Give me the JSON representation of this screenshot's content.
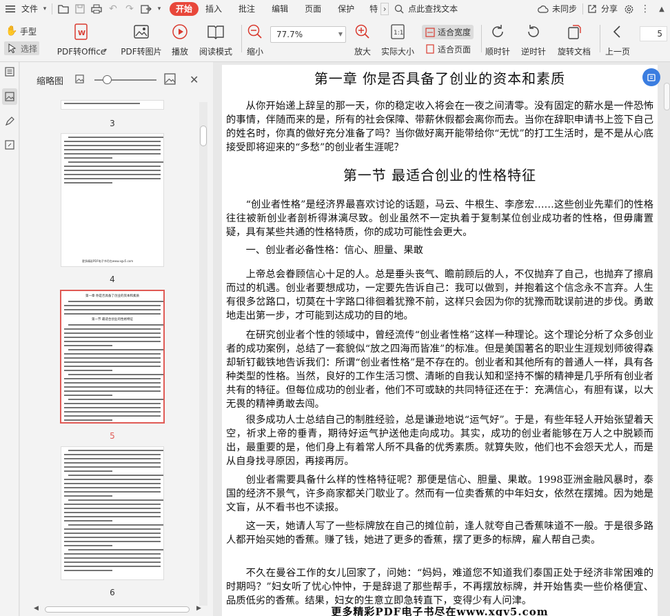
{
  "menubar": {
    "file_label": "文件",
    "tabs": [
      "开始",
      "插入",
      "批注",
      "编辑",
      "页面",
      "保护",
      "特"
    ],
    "search_label": "点此查找文本",
    "sync_label": "未同步",
    "share_label": "分享"
  },
  "ribbon": {
    "hand_label": "手型",
    "select_label": "选择",
    "pdf_to_office_label": "PDF转Office",
    "pdf_to_image_label": "PDF转图片",
    "play_label": "播放",
    "read_mode_label": "阅读模式",
    "zoom_out_label": "缩小",
    "zoom_value": "77.7%",
    "zoom_in_label": "放大",
    "actual_size_label": "实际大小",
    "fit_width_label": "适合宽度",
    "fit_page_label": "适合页面",
    "rotate_cw_label": "顺时针",
    "rotate_ccw_label": "逆时针",
    "rotate_doc_label": "旋转文档",
    "prev_page_label": "上一页",
    "page_number": "5"
  },
  "thumbnail_panel": {
    "title": "缩略图",
    "pages": [
      {
        "label": "3",
        "selected": false
      },
      {
        "label": "4",
        "selected": false
      },
      {
        "label": "5",
        "selected": true
      },
      {
        "label": "6",
        "selected": false
      }
    ],
    "thumb4_footer": "更多精彩PDF电子书尽在www.xgv5.com",
    "thumb5_title": "第一章 你是否具备了创业的资本和素质",
    "thumb5_section": "第一节 最适合创业的性格特征"
  },
  "document": {
    "chapter_title": "第一章 你是否具备了创业的资本和素质",
    "intro": "从你开始递上辞呈的那一天，你的稳定收入将会在一夜之间清零。没有固定的薪水是一件恐怖的事情，伴随而来的是，所有的社会保障、带薪休假都会离你而去。当你在辞职申请书上签下自己的姓名时，你真的做好充分准备了吗？当你做好离开能带给你“无忧”的打工生活时，是不是从心底接受即将迎来的“多愁”的创业者生涯呢？",
    "section_title": "第一节 最适合创业的性格特征",
    "p1": "“创业者性格”是经济界最喜欢讨论的话题，马云、牛根生、李彦宏……这些创业先辈们的性格往往被新创业者剖析得淋漓尽致。创业虽然不一定执着于复制某位创业成功者的性格，但毋庸置疑，具有某些共通的性格特质，你的成功可能性会更大。",
    "p2": "一、创业者必备性格：信心、胆量、果敢",
    "p3": "上帝总会眷顾信心十足的人。总是垂头丧气、瞻前顾后的人，不仅抛弃了自己，也抛弃了擦肩而过的机遇。创业者要想成功，一定要先告诉自己：我可以做到，并抱着这个信念永不言弃。人生有很多岔路口，切莫在十字路口徘徊着犹豫不前，这样只会因为你的犹豫而耽误前进的步伐。勇敢地走出第一步，才可能到达成功的目的地。",
    "p4": "在研究创业者个性的领域中，曾经流传“创业者性格”这样一种理论。这个理论分析了众多创业者的成功案例，总结了一套貌似“放之四海而皆准”的标准。但是美国著名的职业生涯规划师彼得森却斩钉截铁地告诉我们：所谓“创业者性格”是不存在的。创业者和其他所有的普通人一样，具有各种类型的性格。当然，良好的工作生活习惯、清晰的自我认知和坚持不懈的精神是几乎所有创业者共有的特征。但每位成功的创业者，他们不可或缺的共同特征还在于：充满信心，有胆有谋，以大无畏的精神勇敢去闯。",
    "p5": "很多成功人士总结自己的制胜经验，总是谦逊地说“运气好”。于是，有些年轻人开始张望着天空，祈求上帝的垂青，期待好运气护送他走向成功。其实，成功的创业者能够在万人之中脱颖而出，最重要的是，他们身上有着常人所不具备的优秀素质。就算失败，他们也不会怨天尤人，而是从自身找寻原因，再接再厉。",
    "p6": "创业者需要具备什么样的性格特征呢？那便是信心、胆量、果敢。1998亚洲金融风暴时，泰国的经济不景气，许多商家都关门歇业了。然而有一位卖香蕉的中年妇女，依然在摆摊。因为她是文盲，从不看书也不读报。",
    "p7": "这一天，她请人写了一些标牌放在自己的摊位前，逢人就夸自己香蕉味道不一般。于是很多路人都开始买她的香蕉。赚了钱，她进了更多的香蕉，摆了更多的标牌，雇人帮自己卖。",
    "p8": "不久在曼谷工作的女儿回家了，问她：“妈妈，难道您不知道我们泰国正处于经济非常困难的时期吗？”妇女听了忧心忡忡，于是辞退了那些帮手，不再摆放标牌，并开始售卖一些价格便宜、品质低劣的香蕉。结果，妇女的生意立即急转直下，变得少有人问津。",
    "footer": "更多精彩PDF电子书尽在www.xgv5.com"
  },
  "colors": {
    "accent_red": "#e8473a",
    "selected_thumb": "#e05a55",
    "float_button_blue": "#3b7de0"
  }
}
